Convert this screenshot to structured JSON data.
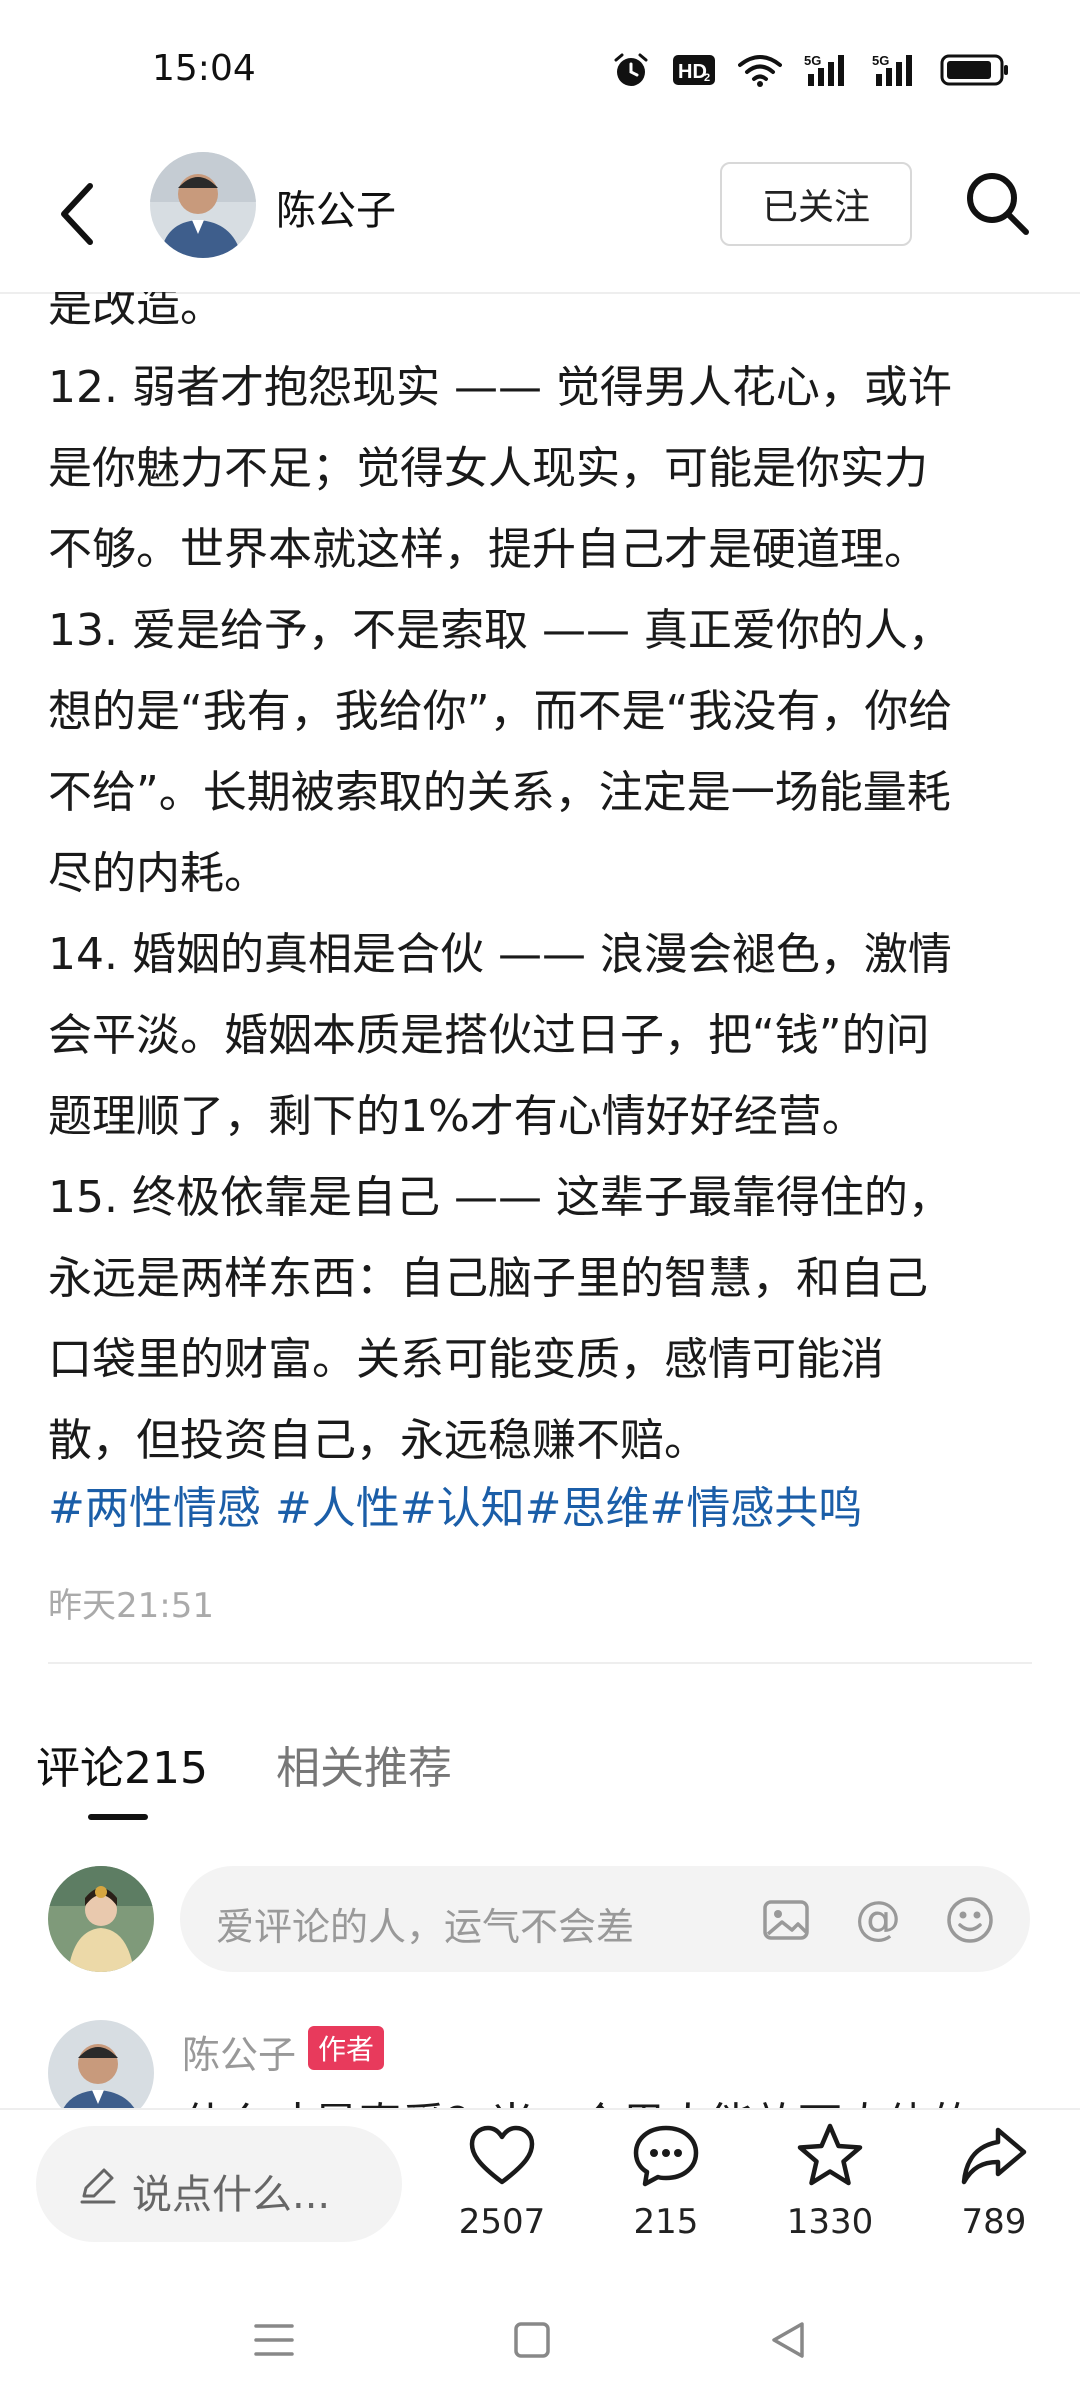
{
  "status_bar": {
    "time": "15:04",
    "icons": [
      "alarm-icon",
      "hd-icon",
      "wifi-icon",
      "signal-5g-icon",
      "signal-5g-icon",
      "battery-icon"
    ],
    "hd_label": "HD",
    "hd_sub": "2",
    "signal1_label": "5G",
    "signal2_label": "5G"
  },
  "header": {
    "author": "陈公子",
    "follow_label": "已关注"
  },
  "article": {
    "lines": [
      "是改造。",
      "12. 弱者才抱怨现实 —— 觉得男人花心，或许",
      "是你魅力不足；觉得女人现实，可能是你实力",
      "不够。世界本就这样，提升自己才是硬道理。",
      "13. 爱是给予，不是索取 —— 真正爱你的人，",
      "想的是“我有，我给你”，而不是“我没有，你给",
      "不给”。长期被索取的关系，注定是一场能量耗",
      "尽的内耗。",
      "14. 婚姻的真相是合伙 —— 浪漫会褪色，激情",
      "会平淡。婚姻本质是搭伙过日子，把“钱”的问",
      "题理顺了，剩下的1%才有心情好好经营。",
      "15. 终极依靠是自己 —— 这辈子最靠得住的，",
      "永远是两样东西：自己脑子里的智慧，和自己",
      "口袋里的财富。关系可能变质，感情可能消",
      "散，但投资自己，永远稳赚不赔。"
    ],
    "hashtags": [
      "#两性情感 ",
      "#人性",
      "#认知",
      "#思维",
      "#情感共鸣"
    ],
    "timestamp": "昨天21:51"
  },
  "tabs": {
    "comments_label": "评论215",
    "related_label": "相关推荐"
  },
  "comment_input": {
    "placeholder": "爱评论的人，运气不会差",
    "icons": [
      "image-icon",
      "mention-icon",
      "emoji-icon"
    ],
    "mention_glyph": "@"
  },
  "first_comment": {
    "name": "陈公子",
    "badge": "作者",
    "text": "什么才是真爱？当一个男人能放下肉体的"
  },
  "bottom_bar": {
    "say_placeholder": "说点什么...",
    "likes": "2507",
    "comments": "215",
    "favorites": "1330",
    "shares": "789"
  },
  "colors": {
    "hashtag": "#1b5ea8",
    "badge": "#e83a5c",
    "muted": "#999999"
  }
}
